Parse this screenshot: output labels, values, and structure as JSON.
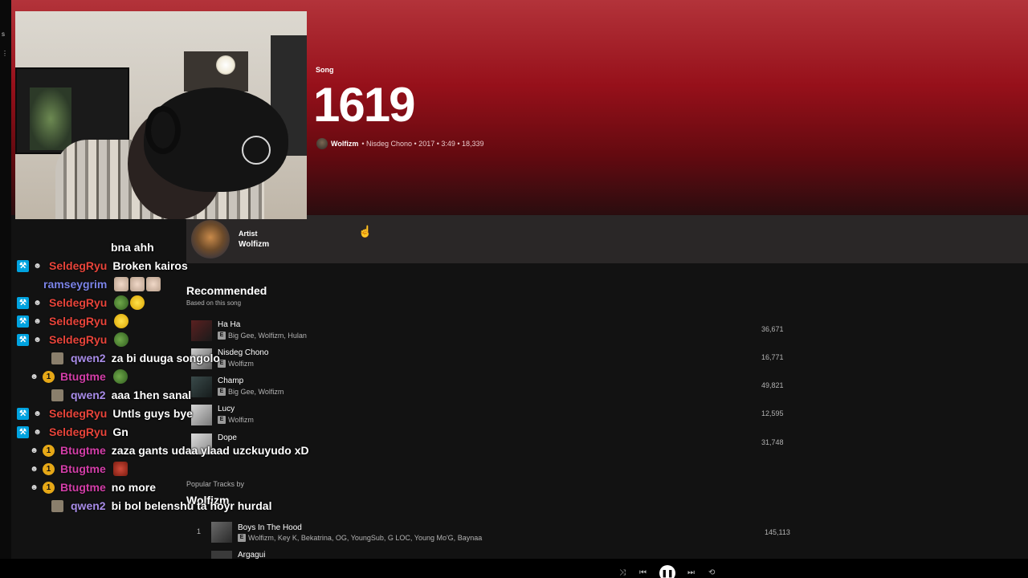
{
  "song": {
    "type_label": "Song",
    "title": "1619",
    "artist": "Wolfizm",
    "meta_rest": "• Nisdeg Chono • 2017 • 3:49 • 18,339"
  },
  "artist_bar": {
    "label": "Artist",
    "name": "Wolfizm"
  },
  "recommended": {
    "title": "Recommended",
    "subtitle": "Based on this song",
    "explicit_badge": "E",
    "tracks": [
      {
        "name": "Ha Ha",
        "artists": "Big Gee, Wolfizm, Hulan",
        "plays": "36,671"
      },
      {
        "name": "Nisdeg Chono",
        "artists": "Wolfizm",
        "plays": "16,771"
      },
      {
        "name": "Champ",
        "artists": "Big Gee, Wolfizm",
        "plays": "49,821"
      },
      {
        "name": "Lucy",
        "artists": "Wolfizm",
        "plays": "12,595"
      },
      {
        "name": "Dope",
        "artists": "",
        "plays": "31,748"
      }
    ]
  },
  "popular": {
    "subtitle": "Popular Tracks by",
    "artist": "Wolfizm",
    "explicit_badge": "E",
    "tracks": [
      {
        "rank": "1",
        "name": "Boys In The Hood",
        "artists": "Wolfizm, Key K, Bekatrina, OG, YoungSub, G LOC, Young Mo'G, Baynaa",
        "plays": "145,113"
      },
      {
        "name": "Argagui"
      }
    ]
  },
  "player": {
    "shuffle_icon": "shuffle-icon",
    "prev_icon": "previous-icon",
    "play_icon": "pause-icon",
    "next_icon": "next-icon",
    "repeat_icon": "repeat-icon"
  },
  "chat": {
    "colors": {
      "red": "#e8443a",
      "blue": "#7b84e8",
      "pink": "#d33ea8",
      "lavender": "#a88ce8"
    },
    "messages": [
      {
        "user": "",
        "text": "bna ahh"
      },
      {
        "user": "SeldegRyu",
        "text": "Broken kairos"
      },
      {
        "user": "ramseygrim",
        "text": ""
      },
      {
        "user": "SeldegRyu",
        "text": ""
      },
      {
        "user": "SeldegRyu",
        "text": ""
      },
      {
        "user": "SeldegRyu",
        "text": ""
      },
      {
        "user": "qwen2",
        "text": "za bi duuga songolo"
      },
      {
        "user": "Btugtme",
        "text": ""
      },
      {
        "user": "qwen2",
        "text": "aaa 1hen sanal"
      },
      {
        "user": "SeldegRyu",
        "text": "Untls guys bye"
      },
      {
        "user": "SeldegRyu",
        "text": "Gn"
      },
      {
        "user": "Btugtme",
        "text": "zaza gants udaa ylaad uzckuyudo xD"
      },
      {
        "user": "Btugtme",
        "text": ""
      },
      {
        "user": "Btugtme",
        "text": "no more"
      },
      {
        "user": "qwen2",
        "text": "bi bol belenshu ta hoyr hurdal"
      }
    ],
    "badge_num": "1"
  }
}
